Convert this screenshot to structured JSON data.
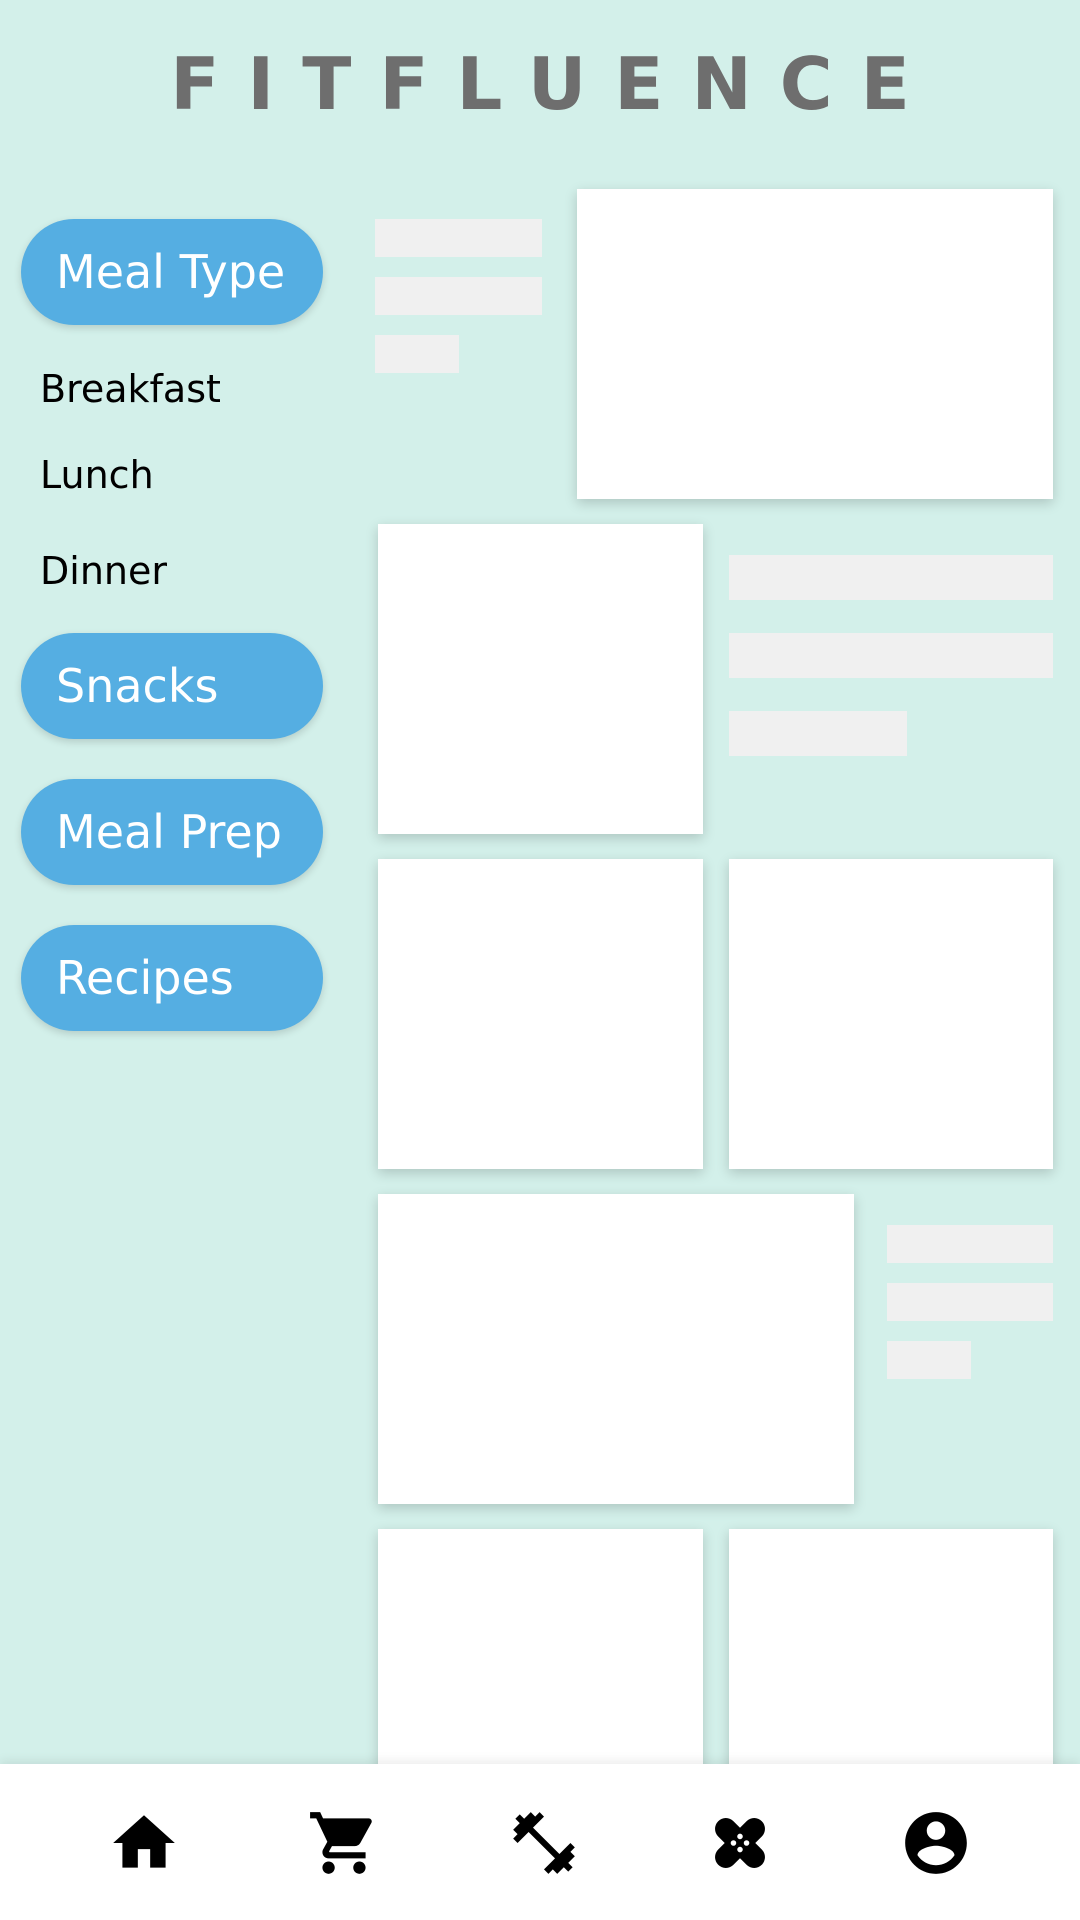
{
  "header": {
    "brand": "FITFLUENCE"
  },
  "sidebar": {
    "meal_type_label": "Meal Type",
    "submenu": [
      "Breakfast",
      "Lunch",
      "Dinner"
    ],
    "snacks_label": "Snacks",
    "meal_prep_label": "Meal Prep",
    "recipes_label": "Recipes"
  },
  "bottom_nav": {
    "items": [
      {
        "icon": "home-icon"
      },
      {
        "icon": "cart-icon"
      },
      {
        "icon": "dumbbell-icon"
      },
      {
        "icon": "bandage-icon"
      },
      {
        "icon": "account-icon"
      }
    ]
  },
  "colors": {
    "background": "#d3f0ea",
    "accent": "#55aee2",
    "brand_text": "#6e6e6e",
    "card": "#ffffff",
    "placeholder": "#f0f0f0"
  }
}
